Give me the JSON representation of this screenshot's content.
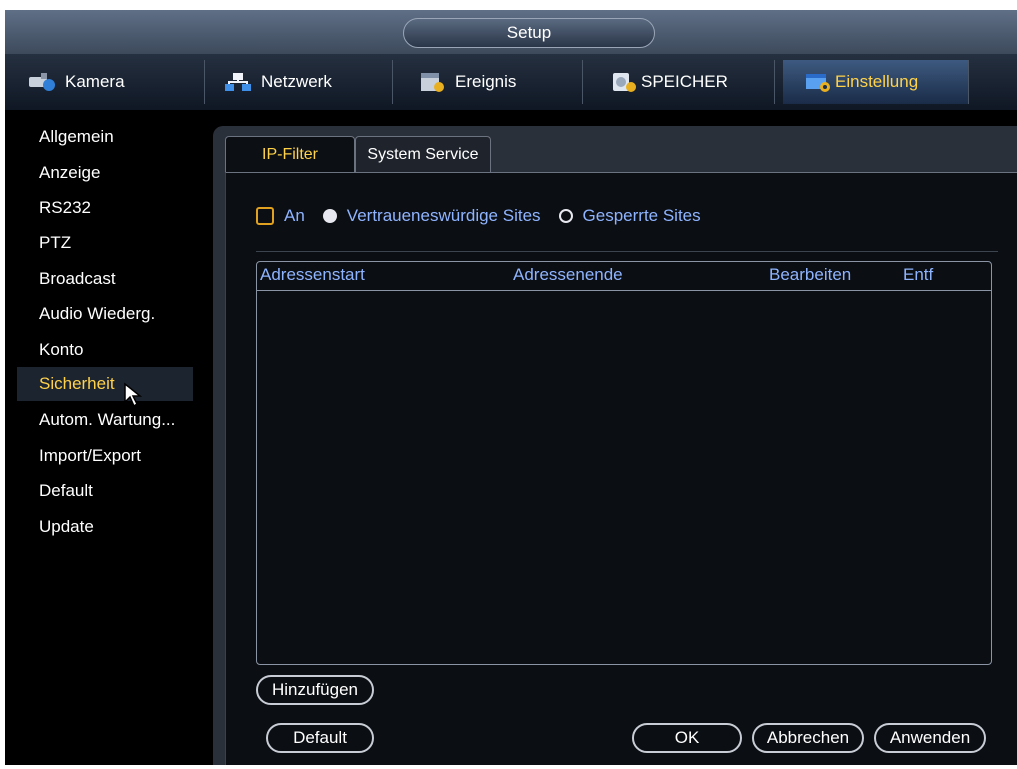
{
  "window": {
    "title": "Setup"
  },
  "top_tabs": [
    {
      "label": "Kamera",
      "icon": "camera-icon"
    },
    {
      "label": "Netzwerk",
      "icon": "network-icon"
    },
    {
      "label": "Ereignis",
      "icon": "event-icon"
    },
    {
      "label": "SPEICHER",
      "icon": "storage-icon"
    },
    {
      "label": "Einstellung",
      "icon": "settings-icon",
      "active": true
    }
  ],
  "sidebar": {
    "items": [
      {
        "label": "Allgemein"
      },
      {
        "label": "Anzeige"
      },
      {
        "label": "RS232"
      },
      {
        "label": "PTZ"
      },
      {
        "label": "Broadcast"
      },
      {
        "label": "Audio Wiederg."
      },
      {
        "label": "Konto"
      },
      {
        "label": "Sicherheit",
        "active": true
      },
      {
        "label": "Autom. Wartung..."
      },
      {
        "label": "Import/Export"
      },
      {
        "label": "Default"
      },
      {
        "label": "Update"
      }
    ]
  },
  "subtabs": [
    {
      "label": "IP-Filter",
      "active": true
    },
    {
      "label": "System Service"
    }
  ],
  "filter": {
    "enable_label": "An",
    "trusted_label": "Vertraueneswürdige Sites",
    "blocked_label": "Gesperrte Sites",
    "trusted_selected": true
  },
  "table": {
    "columns": [
      "Adressenstart",
      "Adressenende",
      "Bearbeiten",
      "Entf"
    ],
    "rows": []
  },
  "buttons": {
    "add": "Hinzufügen",
    "default": "Default",
    "ok": "OK",
    "cancel": "Abbrechen",
    "apply": "Anwenden"
  },
  "colors": {
    "accent": "#ffd24a",
    "label_blue": "#8fb4ff",
    "checkbox_border": "#e0a020"
  }
}
